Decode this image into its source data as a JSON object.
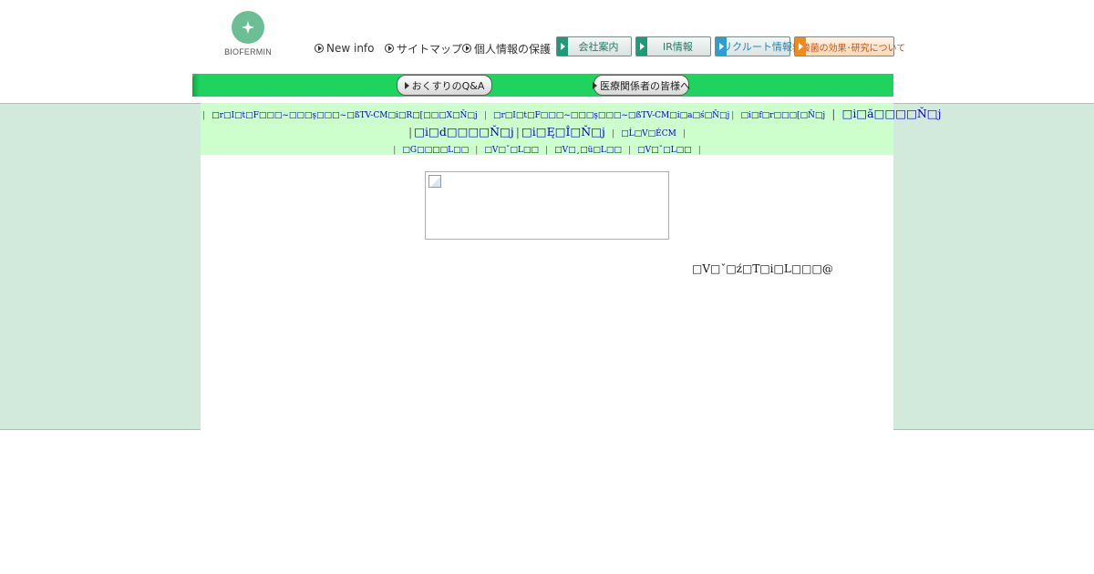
{
  "logo": {
    "text": "BIOFERMIN"
  },
  "top_links": [
    {
      "label": "New info"
    },
    {
      "label": "サイトマップ"
    },
    {
      "label": "個人情報の保護"
    }
  ],
  "top_buttons": [
    {
      "label": "会社案内",
      "accent": "#1e9a78"
    },
    {
      "label": "IR情報",
      "accent": "#1e9a78"
    },
    {
      "label": "リクルート情報",
      "accent": "#2a9fd6"
    },
    {
      "label": "乳酸菌の効果･研究について",
      "accent": "#f08a1a"
    }
  ],
  "nav": {
    "qa_label": "おくすりのQ&A",
    "medical_label": "医療関係者の皆様へ"
  },
  "link_rows": {
    "row1": [
      {
        "text": "□r□I□t□F□□□~□□□ş□□□~□ßTV-CM□i□R□[□□□X□Ň□j",
        "size": "small"
      },
      {
        "text": "□r□I□t□F□□□~□□□ş□□□~□ßTV-CM□i□a□ś□Ň□j",
        "size": "small"
      },
      {
        "text": "□i□f□r□□□[□Ň□j",
        "size": "small"
      },
      {
        "text": "□i□ă□□□□Ň□j",
        "size": "big"
      }
    ],
    "row2": [
      {
        "text": "□i□d□□□□Ň□j",
        "size": "big"
      },
      {
        "text": "□i□Ę□Î□Ň□j",
        "size": "big"
      },
      {
        "text": "□Ĺ□V□ÉCM",
        "size": "small"
      }
    ],
    "row3": [
      {
        "text": "□G□□□□L□□",
        "size": "small"
      },
      {
        "text": "□V□ˇ□L□□",
        "size": "small"
      },
      {
        "text": "□V□¸□ü□L□□",
        "size": "small"
      },
      {
        "text": "□V□ˇ□L□□",
        "size": "small"
      }
    ]
  },
  "main": {
    "garbled_text": "□V□ˇ□ź□T□i□L□□□@"
  },
  "colors": {
    "nav_green": "#1ed45e",
    "link_band": "#ccffcc",
    "side_band": "#d1eadc",
    "link_blue": "#0000cc"
  }
}
